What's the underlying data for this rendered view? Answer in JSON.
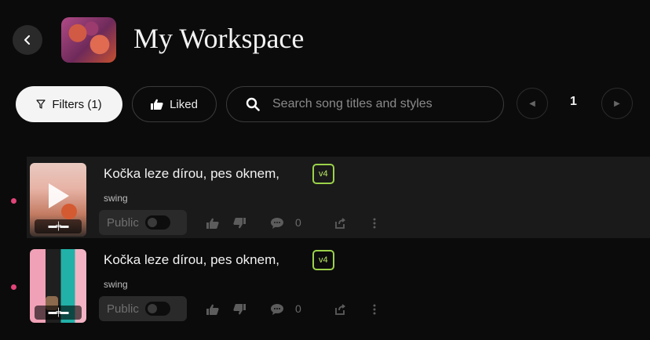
{
  "header": {
    "title": "My Workspace",
    "back_icon": "chevron-left-icon",
    "avatar_icon": "workspace-art"
  },
  "toolbar": {
    "filters_label": "Filters (1)",
    "liked_label": "Liked",
    "search_placeholder": "Search song titles and styles",
    "page_number": "1"
  },
  "songs": [
    {
      "title": "Kočka leze dírou, pes oknem,",
      "style": "swing",
      "version": "v4",
      "visibility_label": "Public",
      "comments": "0",
      "unread": true
    },
    {
      "title": "Kočka leze dírou, pes oknem,",
      "style": "swing",
      "version": "v4",
      "visibility_label": "Public",
      "comments": "0",
      "unread": true
    }
  ],
  "colors": {
    "background": "#0b0b0b",
    "accent_badge": "#9bd24a",
    "unread_dot": "#e2447a"
  }
}
